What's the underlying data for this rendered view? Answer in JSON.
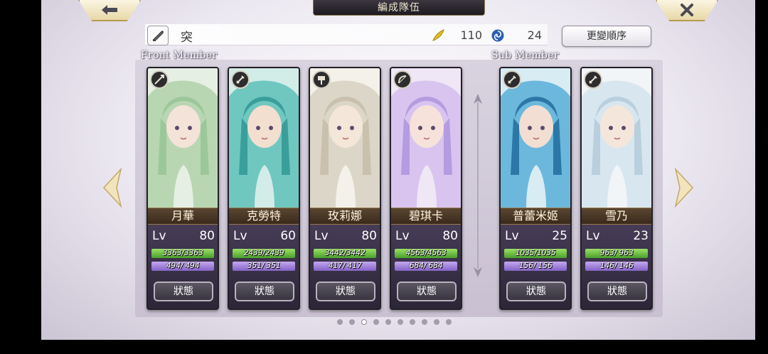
{
  "header": {
    "title": "編成隊伍",
    "back_icon": "arrow-left-icon",
    "close_icon": "close-icon"
  },
  "info_bar": {
    "party_name": "突",
    "cost_value": "110",
    "points_value": "24"
  },
  "buttons": {
    "change_order": "更變順序"
  },
  "sections": {
    "front": "Front Member",
    "sub": "Sub Member"
  },
  "status_label": "狀態",
  "lv_label": "Lv",
  "members": [
    {
      "name": "月華",
      "level": "80",
      "hp": "3363/3363",
      "hp_frac": 1.0,
      "mp": "494/ 494",
      "mp_frac": 1.0,
      "type_icon": "spear-icon",
      "palette": [
        "#e6efe4",
        "#b9d6b3",
        "#9cc79a",
        "#f3e3d8"
      ]
    },
    {
      "name": "克勞特",
      "level": "60",
      "hp": "2439/2439",
      "hp_frac": 1.0,
      "mp": "351/ 351",
      "mp_frac": 1.0,
      "type_icon": "sword-icon",
      "palette": [
        "#d2ece8",
        "#6fc7c0",
        "#3a9e9a",
        "#f2dfcf"
      ]
    },
    {
      "name": "玫莉娜",
      "level": "80",
      "hp": "3442/3442",
      "hp_frac": 1.0,
      "mp": "417/ 417",
      "mp_frac": 1.0,
      "type_icon": "hammer-icon",
      "palette": [
        "#f4f1ea",
        "#dcd6c8",
        "#c9c0ad",
        "#f4e6d8"
      ]
    },
    {
      "name": "碧琪卡",
      "level": "80",
      "hp": "4563/4563",
      "hp_frac": 1.0,
      "mp": "684/ 684",
      "mp_frac": 1.0,
      "type_icon": "bow-icon",
      "palette": [
        "#efe6f6",
        "#d8c4ef",
        "#b59be0",
        "#f6e2db"
      ]
    },
    {
      "name": "普蕾米姬",
      "level": "25",
      "hp": "1035/1035",
      "hp_frac": 1.0,
      "mp": "156/ 156",
      "mp_frac": 1.0,
      "type_icon": "sword-icon",
      "palette": [
        "#d8ecf4",
        "#6cb8dc",
        "#2b77a8",
        "#f2ded2"
      ]
    },
    {
      "name": "雪乃",
      "level": "23",
      "hp": "963/ 963",
      "hp_frac": 1.0,
      "mp": "146/ 146",
      "mp_frac": 1.0,
      "type_icon": "sword-icon",
      "palette": [
        "#f1f5f8",
        "#d8e6ef",
        "#b9cfde",
        "#f5e6dc"
      ]
    }
  ],
  "pagination": {
    "total": 10,
    "current": 3
  },
  "colors": {
    "hp_bar": "#6cc03e",
    "mp_bar": "#a182dc",
    "name_plate": "#4a3826"
  }
}
